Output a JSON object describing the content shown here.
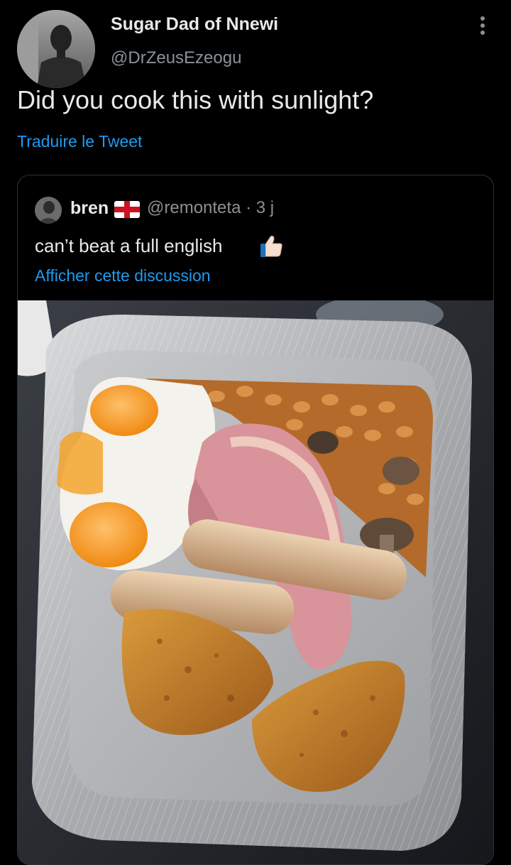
{
  "tweet": {
    "author_name": "Sugar Dad of Nnewi",
    "author_handle": "@DrZeusEzeogu",
    "text": "Did you cook this with sunlight?",
    "translate_label": "Traduire le Tweet"
  },
  "quoted": {
    "author_name": "bren",
    "author_handle": "@remonteta",
    "separator": "·",
    "time": "3 j",
    "text": "can’t beat a full english",
    "show_thread_label": "Afficher cette discussion",
    "flag_icon": "england-flag-icon",
    "emoji_icon": "thumbs-up-icon"
  },
  "colors": {
    "background": "#000000",
    "primary_text": "#e7e9ea",
    "secondary_text": "#8b9196",
    "link": "#1d9bf0",
    "card_border": "#2f3336"
  }
}
